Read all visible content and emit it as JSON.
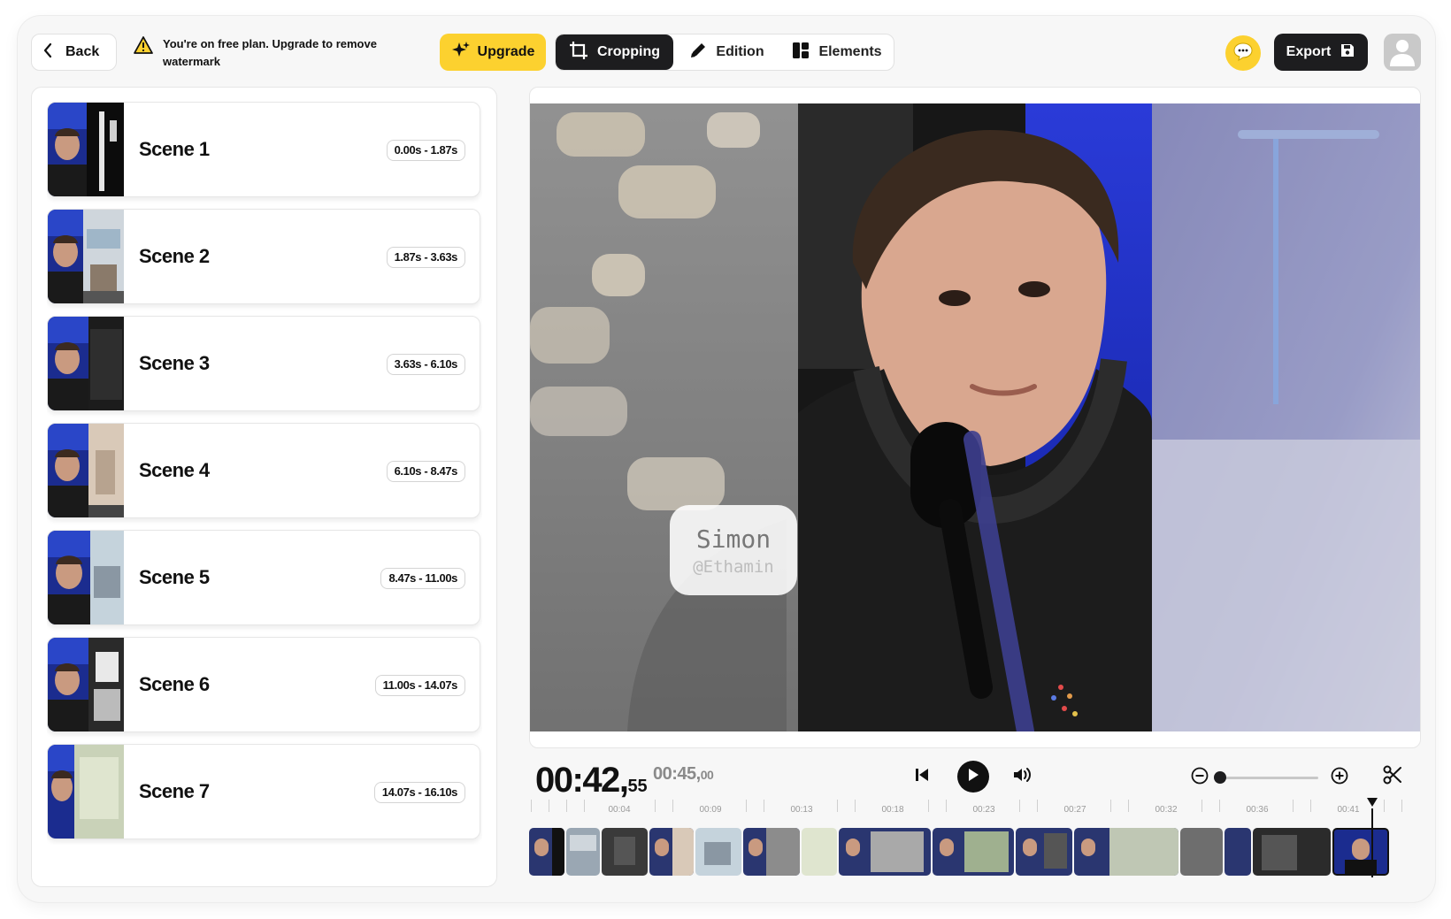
{
  "topbar": {
    "back_label": "Back",
    "notice_text": "You're on free plan. Upgrade to remove watermark",
    "upgrade_label": "Upgrade",
    "modes": [
      {
        "label": "Cropping",
        "icon": "crop-icon",
        "active": true
      },
      {
        "label": "Edition",
        "icon": "pencil-icon",
        "active": false
      },
      {
        "label": "Elements",
        "icon": "layout-icon",
        "active": false
      }
    ],
    "export_label": "Export",
    "accent_color": "#fcd12f"
  },
  "scenes": [
    {
      "title": "Scene 1",
      "time": "0.00s - 1.87s"
    },
    {
      "title": "Scene 2",
      "time": "1.87s - 3.63s"
    },
    {
      "title": "Scene 3",
      "time": "3.63s - 6.10s"
    },
    {
      "title": "Scene 4",
      "time": "6.10s - 8.47s"
    },
    {
      "title": "Scene 5",
      "time": "8.47s - 11.00s"
    },
    {
      "title": "Scene 6",
      "time": "11.00s - 14.07s"
    },
    {
      "title": "Scene 7",
      "time": "14.07s - 16.10s"
    }
  ],
  "preview": {
    "name_tag": {
      "name": "Simon",
      "handle": "@Ethamin"
    }
  },
  "player": {
    "current_main": "00:42",
    "current_ms": "55",
    "total_main": "00:45",
    "total_ms": "00",
    "zoom_level": 0.05
  },
  "timeline": {
    "labels": [
      "00:04",
      "00:09",
      "00:13",
      "00:18",
      "00:23",
      "00:27",
      "00:32",
      "00:36",
      "00:41"
    ]
  }
}
